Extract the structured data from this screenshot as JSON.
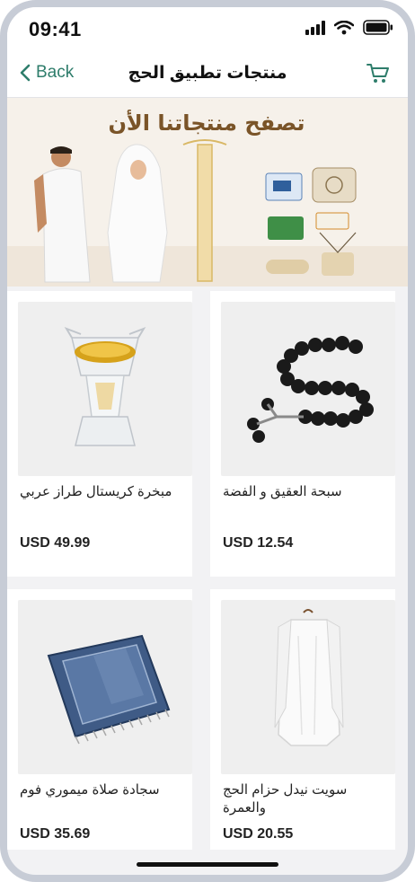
{
  "status_bar": {
    "time": "09:41"
  },
  "nav": {
    "back_label": "Back",
    "title": "منتجات تطبيق الحج"
  },
  "banner": {
    "headline": "تصفح منتجاتنا الأن"
  },
  "products": [
    {
      "name": "مبخرة كريستال طراز عربي",
      "price": "USD 49.99",
      "icon": "crystal-incense-burner"
    },
    {
      "name": "سبحة العقيق و الفضة",
      "price": "USD 12.54",
      "icon": "prayer-beads"
    },
    {
      "name": "سجادة صلاة ميموري فوم",
      "price": "USD 35.69",
      "icon": "prayer-rug"
    },
    {
      "name": "سويت نيدل حزام الحج والعمرة",
      "price": "USD 20.55",
      "icon": "ihram-cloth"
    }
  ],
  "colors": {
    "accent": "#2e7d6b",
    "background": "#f2f2f4",
    "card": "#ffffff"
  }
}
